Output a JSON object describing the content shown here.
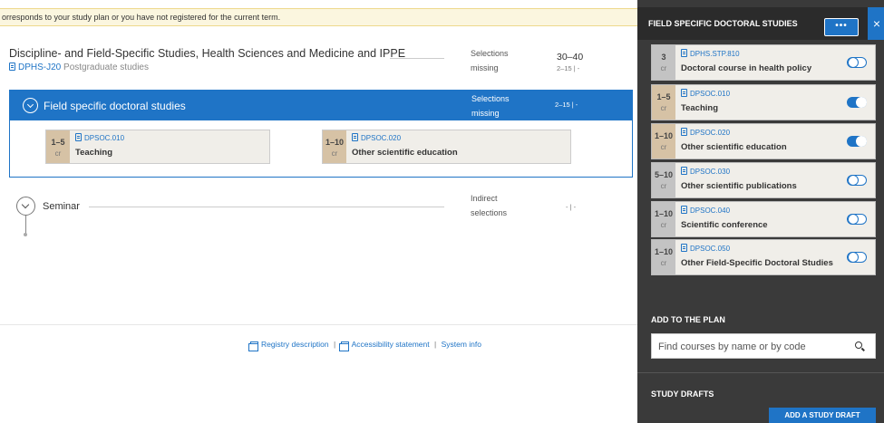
{
  "notice": {
    "text": "orresponds to your study plan or you have not registered for the current term."
  },
  "discipline": {
    "title": "Discipline- and Field-Specific Studies, Health Sciences and Medicine and IPPE",
    "code": "DPHS-J20",
    "subtitle": "Postgraduate studies",
    "selections_label_1": "Selections",
    "selections_label_2": "missing",
    "credits": "30–40",
    "credits_sub": "2–15 | -"
  },
  "field_section": {
    "title": "Field specific doctoral studies",
    "selections_label_1": "Selections",
    "selections_label_2": "missing",
    "credits_sub": "2–15 | -",
    "courses": [
      {
        "cr": "1–5",
        "unit": "cr",
        "code": "DPSOC.010",
        "name": "Teaching"
      },
      {
        "cr": "1–10",
        "unit": "cr",
        "code": "DPSOC.020",
        "name": "Other scientific education"
      }
    ]
  },
  "seminar": {
    "title": "Seminar",
    "selections_label_1": "Indirect",
    "selections_label_2": "selections",
    "credits_sub": "- | -"
  },
  "footer": {
    "registry": "Registry description",
    "accessibility": "Accessibility statement",
    "system": "System info",
    "sep": "|"
  },
  "panel": {
    "title": "FIELD SPECIFIC DOCTORAL STUDIES",
    "more": "•••",
    "close": "×",
    "courses": [
      {
        "cr": "3",
        "unit": "cr",
        "code": "DPHS.STP.810",
        "name": "Doctoral course in health policy",
        "on": false
      },
      {
        "cr": "1–5",
        "unit": "cr",
        "code": "DPSOC.010",
        "name": "Teaching",
        "on": true
      },
      {
        "cr": "1–10",
        "unit": "cr",
        "code": "DPSOC.020",
        "name": "Other scientific education",
        "on": true
      },
      {
        "cr": "5–10",
        "unit": "cr",
        "code": "DPSOC.030",
        "name": "Other scientific publications",
        "on": false
      },
      {
        "cr": "1–10",
        "unit": "cr",
        "code": "DPSOC.040",
        "name": "Scientific conference",
        "on": false
      },
      {
        "cr": "1–10",
        "unit": "cr",
        "code": "DPSOC.050",
        "name": "Other Field-Specific Doctoral Studies",
        "on": false
      }
    ],
    "add_label": "ADD TO THE PLAN",
    "search_placeholder": "Find courses by name or by code",
    "drafts_label": "STUDY DRAFTS",
    "add_draft": "ADD A STUDY DRAFT"
  },
  "colors": {
    "accent": "#1f74c6",
    "credit_bg": "#d6c2a5",
    "panel_bg": "#3a3a3a",
    "notice_bg": "#fbf6df"
  }
}
